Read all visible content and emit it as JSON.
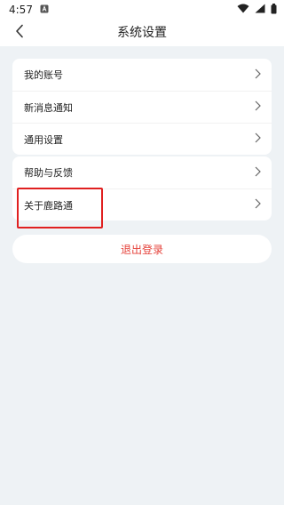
{
  "status_bar": {
    "time": "4:57",
    "icons": [
      "notification-a-icon",
      "wifi-icon",
      "signal-icon",
      "battery-icon"
    ]
  },
  "header": {
    "back_icon": "chevron-left-icon",
    "title": "系统设置"
  },
  "settings_group_1": {
    "items": [
      {
        "label": "我的账号",
        "icon": "chevron-right-icon"
      },
      {
        "label": "新消息通知",
        "icon": "chevron-right-icon"
      },
      {
        "label": "通用设置",
        "icon": "chevron-right-icon"
      }
    ]
  },
  "settings_group_2": {
    "items": [
      {
        "label": "帮助与反馈",
        "icon": "chevron-right-icon"
      },
      {
        "label": "关于鹿路通",
        "icon": "chevron-right-icon"
      }
    ]
  },
  "logout": {
    "label": "退出登录"
  },
  "colors": {
    "background": "#eef2f5",
    "card": "#ffffff",
    "logout_text": "#e5413a",
    "highlight": "#e02020"
  }
}
